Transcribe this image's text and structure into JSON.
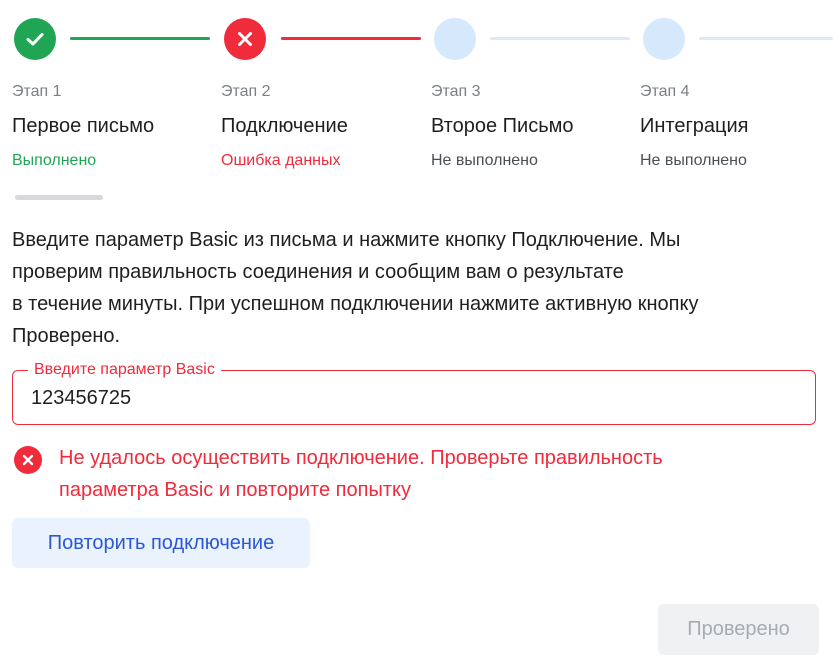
{
  "steps": [
    {
      "number": "Этап 1",
      "title": "Первое письмо",
      "status": "Выполнено",
      "state": "done"
    },
    {
      "number": "Этап 2",
      "title": "Подключение",
      "status": "Ошибка данных",
      "state": "error"
    },
    {
      "number": "Этап 3",
      "title": "Второе Письмо",
      "status": "Не выполнено",
      "state": "todo"
    },
    {
      "number": "Этап 4",
      "title": "Интеграция",
      "status": "Не выполнено",
      "state": "todo"
    }
  ],
  "instruction": {
    "line1": "Введите параметр Basic из письма и нажмите кнопку Подключение. Мы",
    "line2": "проверим правильность соединения и сообщим вам о результате",
    "line3": "в течение минуты. При успешном подключении нажмите активную кнопку",
    "line4": "Проверено."
  },
  "basic_field": {
    "label": "Введите параметр Basic",
    "value": "123456725"
  },
  "error_message": {
    "line1": "Не удалось осуществить подключение. Проверьте правильность",
    "line2": "параметра Basic и повторите попытку"
  },
  "buttons": {
    "retry_label": "Повторить подключение",
    "verified_label": "Проверено"
  },
  "colors": {
    "success": "#20a555",
    "error": "#ef2b3c",
    "pending": "#d6e8fb",
    "link_blue": "#2b57d6",
    "retry_bg": "#eaf3fd",
    "disabled_bg": "#f0f1f3",
    "disabled_text": "#a7abb2"
  },
  "icons": {
    "step_done": "check-icon",
    "step_error": "cross-icon",
    "error_message": "error-icon"
  }
}
